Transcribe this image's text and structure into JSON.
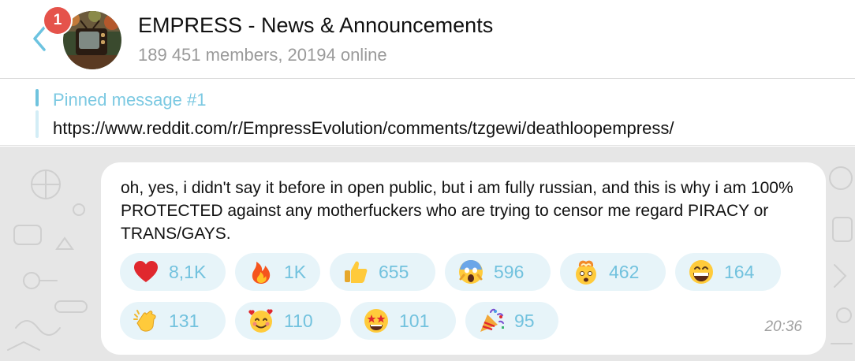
{
  "header": {
    "back_icon": "chevron-left-icon",
    "unread_badge": "1",
    "title": "EMPRESS - News & Announcements",
    "subtitle": "189 451 members, 20194 online"
  },
  "pinned": {
    "title": "Pinned message #1",
    "text": "https://www.reddit.com/r/EmpressEvolution/comments/tzgewi/deathloopempress/"
  },
  "message": {
    "text": "oh, yes, i didn't say it before in open public, but i am fully russian, and this is why i am 100% PROTECTED against any motherfuckers who are trying to censor me regard PIRACY or TRANS/GAYS.",
    "time": "20:36",
    "reactions": [
      {
        "emoji": "red-heart-icon",
        "count": "8,1K"
      },
      {
        "emoji": "fire-icon",
        "count": "1K"
      },
      {
        "emoji": "thumbs-up-icon",
        "count": "655"
      },
      {
        "emoji": "screaming-face-icon",
        "count": "596"
      },
      {
        "emoji": "exploding-head-icon",
        "count": "462"
      },
      {
        "emoji": "grinning-face-icon",
        "count": "164"
      },
      {
        "emoji": "clapping-hands-icon",
        "count": "131"
      },
      {
        "emoji": "smiling-face-with-hearts-icon",
        "count": "110"
      },
      {
        "emoji": "star-struck-icon",
        "count": "101"
      },
      {
        "emoji": "party-popper-icon",
        "count": "95"
      }
    ]
  },
  "colors": {
    "accent": "#72c2de",
    "reaction_bg": "#e7f4f9",
    "badge": "#e5534b",
    "wallpaper": "#e6e6e6"
  }
}
